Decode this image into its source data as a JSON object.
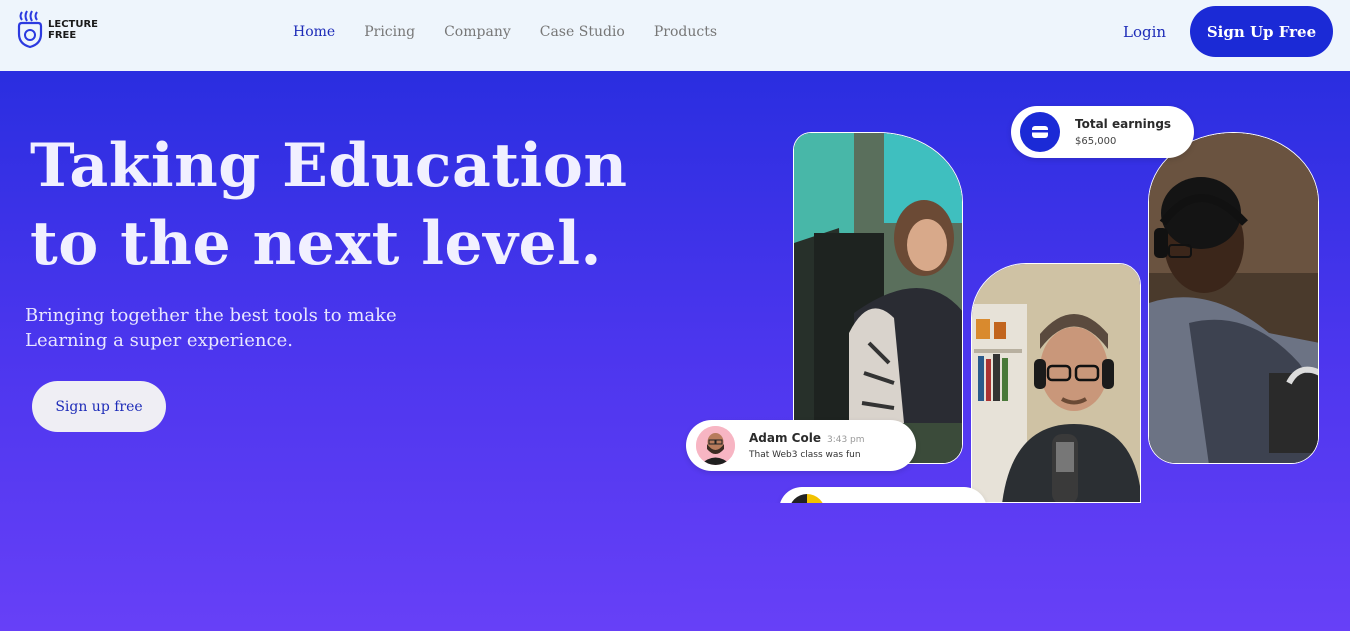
{
  "brand": {
    "name_line1": "LECTURE",
    "name_line2": "FREE"
  },
  "nav": {
    "links": [
      "Home",
      "Pricing",
      "Company",
      "Case Studio",
      "Products"
    ],
    "active": "Home",
    "login": "Login",
    "signup": "Sign Up Free"
  },
  "hero": {
    "title": "Taking Education to the next level.",
    "subtitle": "Bringing together the best tools to make Learning a super experience.",
    "cta": "Sign up free"
  },
  "earnings_card": {
    "title": "Total earnings",
    "value": "$65,000"
  },
  "chat_card": {
    "name": "Adam Cole",
    "time": "3:43 pm",
    "message": "That Web3 class was fun"
  },
  "colors": {
    "accent": "#1b2ad6",
    "hero_top": "#2a2ee0",
    "hero_bottom": "#6740f7",
    "nav_bg": "#eef5fc"
  },
  "icons": {
    "logo": "brain-bulb-icon",
    "earnings": "credit-card-icon"
  }
}
